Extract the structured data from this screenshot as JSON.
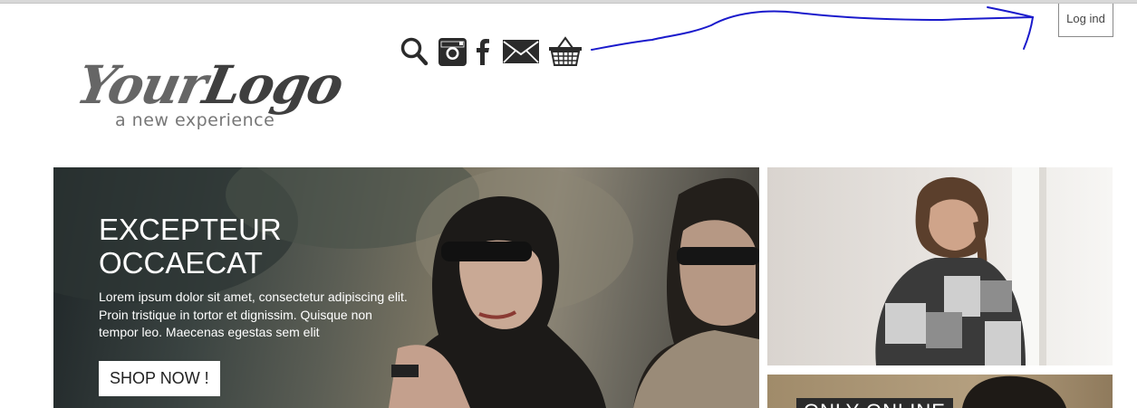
{
  "header": {
    "login_label": "Log ind",
    "icons": [
      "search-icon",
      "instagram-icon",
      "facebook-icon",
      "mail-icon",
      "basket-icon"
    ]
  },
  "logo": {
    "main_a": "Your",
    "main_b": "Logo",
    "sub": "a new experience"
  },
  "hero": {
    "title_line1": "EXCEPTEUR",
    "title_line2": "OCCAECAT",
    "body": "Lorem ipsum dolor sit amet, consectetur adipiscing elit. Proin tristique in tortor et dignissim. Quisque non tempor leo. Maecenas egestas sem elit",
    "cta_label": "SHOP NOW !"
  },
  "promo": {
    "label": "ONLY ONLINE"
  },
  "colors": {
    "annotation_stroke": "#1a1acc",
    "icon": "#2b2b2b"
  }
}
